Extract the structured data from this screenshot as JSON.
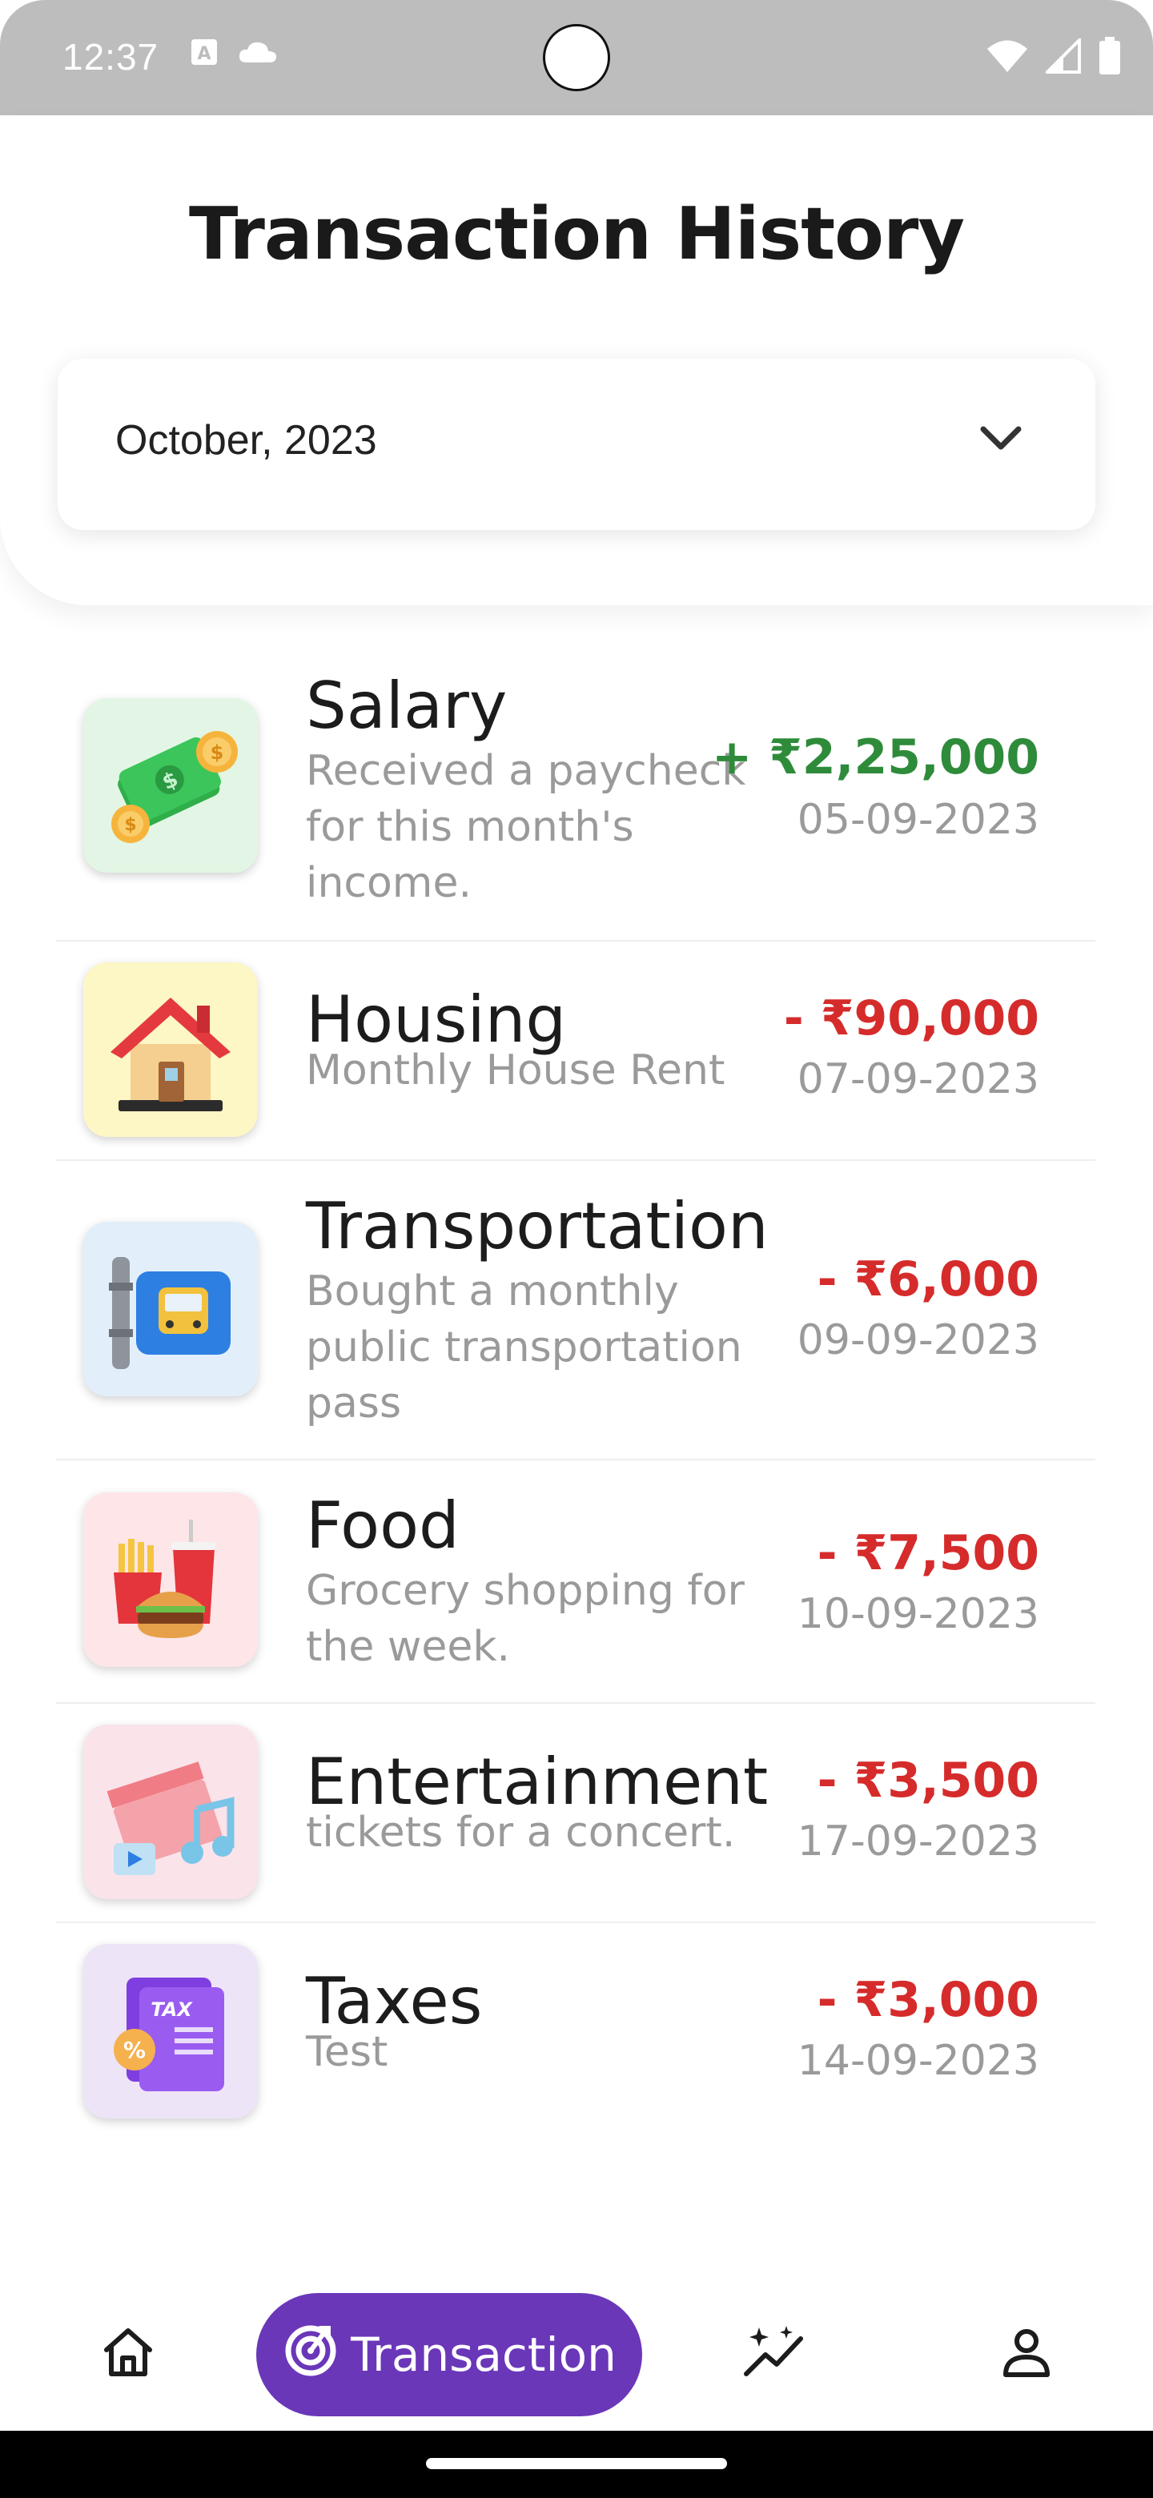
{
  "status_bar": {
    "time": "12:37",
    "left_icons": [
      "font-a-icon",
      "cloud-icon"
    ],
    "right_icons": [
      "wifi-icon",
      "signal-icon",
      "battery-icon"
    ]
  },
  "header": {
    "title": "Transaction History",
    "month_select": {
      "value": "October, 2023",
      "icon": "chevron-down-icon"
    }
  },
  "transactions": [
    {
      "category": "Salary",
      "description": "Received a paycheck for this month's income.",
      "amount": "+ ₹2,25,000",
      "date": "05-09-2023",
      "type": "income",
      "icon": "money-bills-icon",
      "icon_bg": "#e3f6e5"
    },
    {
      "category": "Housing",
      "description": "Monthly House Rent",
      "amount": "- ₹90,000",
      "date": "07-09-2023",
      "type": "expense",
      "icon": "house-icon",
      "icon_bg": "#fdf6c5"
    },
    {
      "category": "Transportation",
      "description": "Bought a monthly public transportation pass",
      "amount": "- ₹6,000",
      "date": "09-09-2023",
      "type": "expense",
      "icon": "bus-stop-icon",
      "icon_bg": "#e2effb"
    },
    {
      "category": "Food",
      "description": "Grocery shopping for the week.",
      "amount": "- ₹7,500",
      "date": "10-09-2023",
      "type": "expense",
      "icon": "fast-food-icon",
      "icon_bg": "#fde5e8"
    },
    {
      "category": "Entertainment",
      "description": "tickets for a concert.",
      "amount": "- ₹3,500",
      "date": "17-09-2023",
      "type": "expense",
      "icon": "clapperboard-music-icon",
      "icon_bg": "#fbe3ea"
    },
    {
      "category": "Taxes",
      "description": "Test",
      "amount": "- ₹3,000",
      "date": "14-09-2023",
      "type": "expense",
      "icon": "tax-document-icon",
      "icon_bg": "#eee4f8"
    }
  ],
  "bottom_nav": {
    "items": [
      {
        "name": "home",
        "icon": "home-icon"
      },
      {
        "name": "transaction",
        "label": "Transaction",
        "icon": "transaction-target-icon",
        "active": true
      },
      {
        "name": "insights",
        "icon": "sparkle-chart-icon"
      },
      {
        "name": "profile",
        "icon": "person-icon"
      }
    ]
  },
  "colors": {
    "accent": "#6a37b9",
    "income": "#2e8b3a",
    "expense": "#d62b2b",
    "muted_text": "#9a9a9a",
    "status_bar": "#bdbdbd"
  }
}
